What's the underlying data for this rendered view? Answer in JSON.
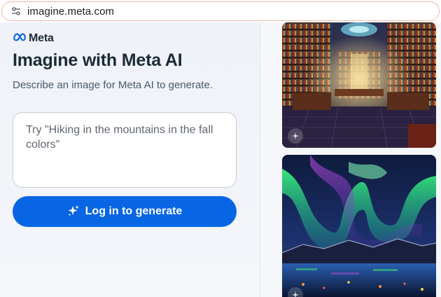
{
  "browser": {
    "url": "imagine.meta.com",
    "site_info_icon": "tune-icon"
  },
  "left_panel": {
    "logo_text": "Meta",
    "logo_icon": "meta-infinity-icon",
    "title": "Imagine with Meta AI",
    "subtitle": "Describe an image for Meta AI to generate.",
    "prompt": {
      "value": "",
      "placeholder": "Try \"Hiking in the mountains in the fall colors\""
    },
    "login_button": {
      "label": "Log in to generate",
      "icon": "sparkle-icon"
    },
    "colors": {
      "accent": "#0866e4",
      "title_text": "#1c2b33"
    }
  },
  "gallery": {
    "images": [
      {
        "subject": "library"
      },
      {
        "subject": "aurora"
      }
    ]
  }
}
